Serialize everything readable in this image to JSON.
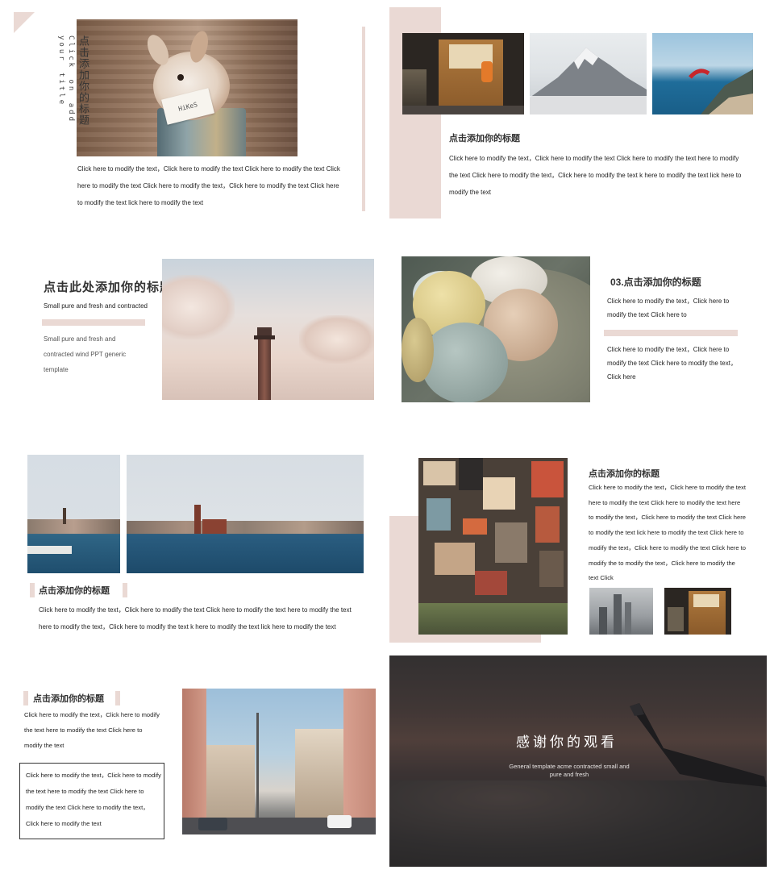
{
  "colors": {
    "accent": "#ead9d4",
    "text": "#222222",
    "dark_bg": "#2d2b2c"
  },
  "slide1": {
    "title_vertical": "点击添加你的标题",
    "subtitle_vertical": "Click on add your title",
    "body": "Click here to modify the text，Click here to modify the text  Click here to modify the text Click here to modify the text Click here to modify the text，Click here to modify the text  Click here to modify the text lick here to modify the text",
    "card_text": "HiKeS"
  },
  "slide2": {
    "title": "点击添加你的标题",
    "body": "Click here to modify the text，Click here to modify the text  Click here to modify the text here to modify the text Click here to modify the text，Click here to modify the text  k here to modify the text lick here to modify the text"
  },
  "slide3": {
    "title": "点击此处添加你的标题",
    "subtitle": "Small pure and fresh and contracted",
    "body": "Small pure and fresh and contracted wind PPT generic template"
  },
  "slide4": {
    "title": "03.点击添加你的标题",
    "body1": "Click here to modify the text，Click here to modify the text  Click here to",
    "body2": "Click here to modify the text，Click here to modify the text  Click here to modify the text，Click here"
  },
  "slide5": {
    "title": "点击添加你的标题",
    "body": "Click here to modify the text，Click here to modify the text  Click here to modify the text here to modify the text here to modify the text，Click here to modify the text  k here to modify the text lick here to modify the text"
  },
  "slide6": {
    "title": "点击添加你的标题",
    "body": "Click here to modify the text，Click here to modify the text here to modify the text Click here to modify the text  here to modify the text，Click here to modify the text  Click here to modify the text lick here to modify the text Click here to modify the text，Click here to modify the text  Click here to modify the  to modify the text，Click here to modify the text  Click"
  },
  "slide7": {
    "title": "点击添加你的标题",
    "body1": "Click here to modify the text，Click here to modify the text   here to modify the text Click here to modify the text",
    "body2": "Click here to modify the text，Click here to modify the text   here to modify the text Click here to modify the text Click here to modify the text，Click here to modify the text"
  },
  "slide8": {
    "title": "感谢你的观看",
    "subtitle": "General template acme contracted small and pure and fresh"
  }
}
